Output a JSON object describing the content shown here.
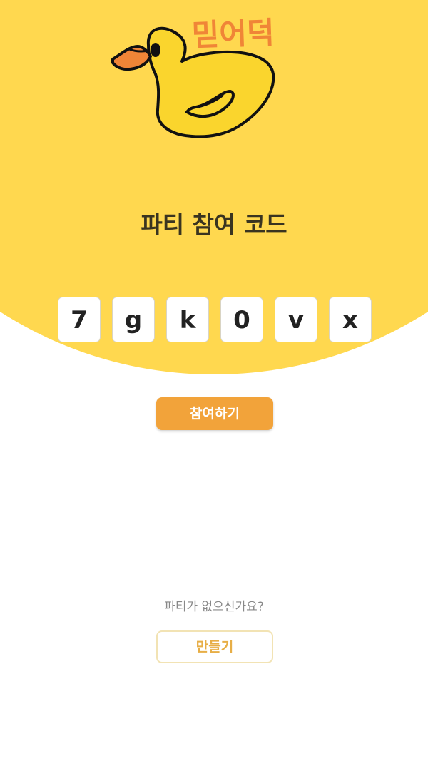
{
  "app": {
    "logo_text": "믿어덕",
    "accent_color": "#ffd84f",
    "button_color": "#f2a33a"
  },
  "main": {
    "title": "파티 참여 코드",
    "code_chars": [
      "7",
      "g",
      "k",
      "0",
      "v",
      "x"
    ],
    "join_button_label": "참여하기",
    "no_party_text": "파티가 없으신가요?",
    "create_button_label": "만들기"
  }
}
